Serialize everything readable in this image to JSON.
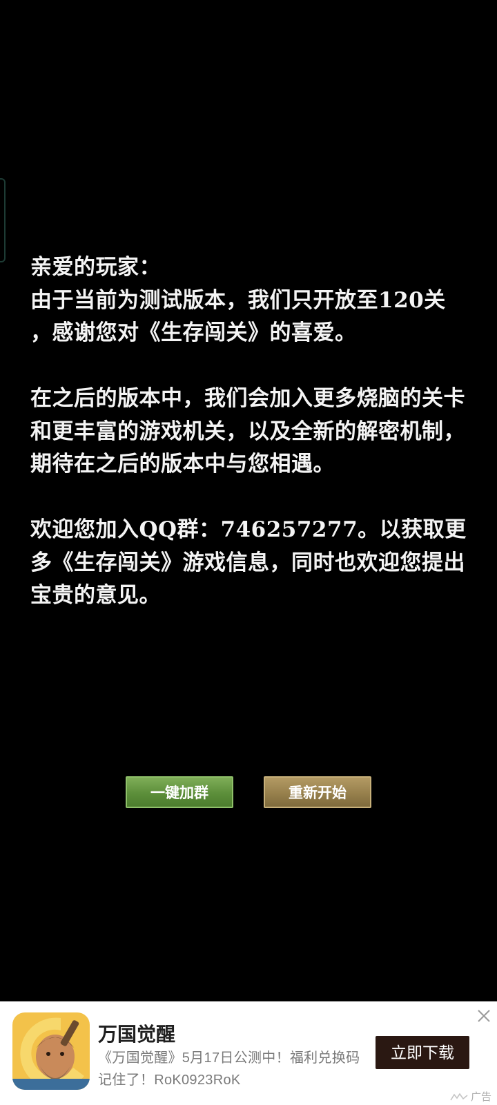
{
  "notice": {
    "greeting": "亲爱的玩家：",
    "paragraph1": "由于当前为测试版本，我们只开放至120关\n，感谢您对《生存闯关》的喜爱。",
    "paragraph2": "在之后的版本中，我们会加入更多烧脑的关卡和更丰富的游戏机关，以及全新的解密机制，期待在之后的版本中与您相遇。",
    "paragraph3": "欢迎您加入QQ群：746257277。以获取更多《生存闯关》游戏信息，同时也欢迎您提出宝贵的意见。"
  },
  "buttons": {
    "join_group": "一键加群",
    "restart": "重新开始"
  },
  "ad": {
    "title": "万国觉醒",
    "description": "《万国觉醒》5月17日公测中！福利兑换码记住了！RoK0923RoK",
    "cta": "立即下载",
    "label": "广告",
    "close_icon": "close-icon",
    "logo_icon": "game-character-logo"
  },
  "colors": {
    "background": "#000000",
    "text": "#f4f4f4",
    "join_button": "#5c8e3a",
    "restart_button": "#97804c",
    "ad_cta": "#2a1812"
  }
}
